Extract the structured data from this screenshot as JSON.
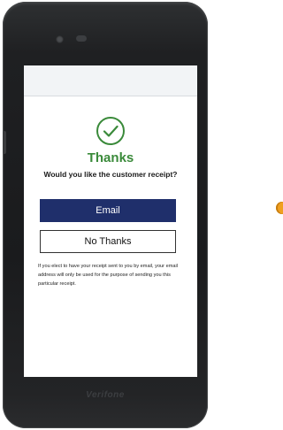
{
  "screen": {
    "title": "Thanks",
    "question": "Would you like the customer receipt?",
    "email_button": "Email",
    "no_thanks_button": "No Thanks",
    "disclaimer": "If you elect to have your receipt sent to you by email, your email address will only be used for the purpose of sending you this particular receipt."
  },
  "device": {
    "brand": "Verifone"
  },
  "icons": {
    "success": "check-circle-icon"
  },
  "colors": {
    "success_green": "#3a8a3a",
    "primary_button": "#1f2f6b",
    "indicator": "#f0a020"
  }
}
